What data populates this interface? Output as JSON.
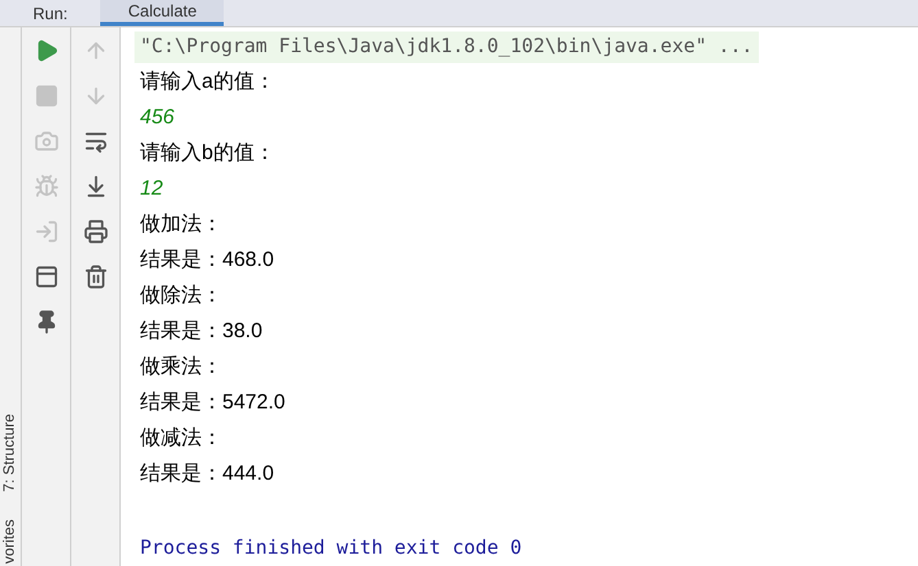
{
  "tool_window": {
    "title": "Run:",
    "tabs": [
      {
        "label": "Calculate",
        "selected": true
      }
    ]
  },
  "side_labels": [
    "7: Structure",
    "vorites"
  ],
  "toolbar_1": [
    {
      "kind": "run",
      "disabled": false
    },
    {
      "kind": "stop",
      "disabled": true
    },
    {
      "kind": "camera",
      "disabled": true
    },
    {
      "kind": "bug",
      "disabled": true
    },
    {
      "kind": "login",
      "disabled": true
    },
    {
      "kind": "layout",
      "disabled": false
    },
    {
      "kind": "pin",
      "disabled": false
    }
  ],
  "toolbar_2": [
    {
      "kind": "up",
      "disabled": true
    },
    {
      "kind": "down",
      "disabled": true
    },
    {
      "kind": "wrap",
      "disabled": false
    },
    {
      "kind": "scroll_end",
      "disabled": false
    },
    {
      "kind": "print",
      "disabled": false
    },
    {
      "kind": "trash",
      "disabled": false
    }
  ],
  "console": [
    {
      "kind": "command",
      "text": "\"C:\\Program Files\\Java\\jdk1.8.0_102\\bin\\java.exe\" ..."
    },
    {
      "kind": "output",
      "text": "请输入a的值："
    },
    {
      "kind": "input",
      "text": "456"
    },
    {
      "kind": "output",
      "text": "请输入b的值："
    },
    {
      "kind": "input",
      "text": "12"
    },
    {
      "kind": "output",
      "text": "做加法："
    },
    {
      "kind": "output",
      "text": "结果是：468.0"
    },
    {
      "kind": "output",
      "text": "做除法："
    },
    {
      "kind": "output",
      "text": "结果是：38.0"
    },
    {
      "kind": "output",
      "text": "做乘法："
    },
    {
      "kind": "output",
      "text": "结果是：5472.0"
    },
    {
      "kind": "output",
      "text": "做减法："
    },
    {
      "kind": "output",
      "text": "结果是：444.0"
    },
    {
      "kind": "blank"
    },
    {
      "kind": "exit",
      "text": "Process finished with exit code 0"
    }
  ]
}
